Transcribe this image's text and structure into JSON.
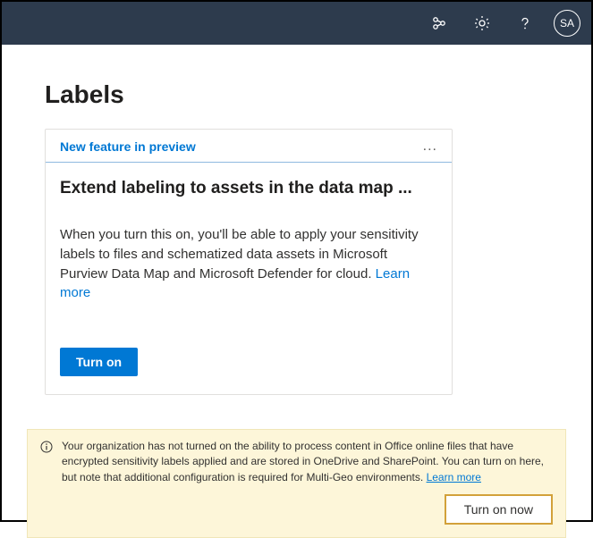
{
  "header": {
    "avatar_initials": "SA"
  },
  "page": {
    "title": "Labels"
  },
  "card": {
    "preview_label": "New feature in preview",
    "ellipsis": "...",
    "title": "Extend labeling to assets in the data map ...",
    "description": "When you turn this on, you'll be able to apply your sensitivity labels to files and schematized data assets in Microsoft Purview Data Map and Microsoft Defender for cloud. ",
    "learn_more": "Learn more",
    "turn_on": "Turn on"
  },
  "banner": {
    "text": "Your organization has not turned on the ability to process content in Office online files that have encrypted sensitivity labels applied and are stored in OneDrive and SharePoint. You can turn on here, but note that additional configuration is required for Multi-Geo environments. ",
    "learn_more": "Learn more",
    "turn_on_now": "Turn on now"
  }
}
